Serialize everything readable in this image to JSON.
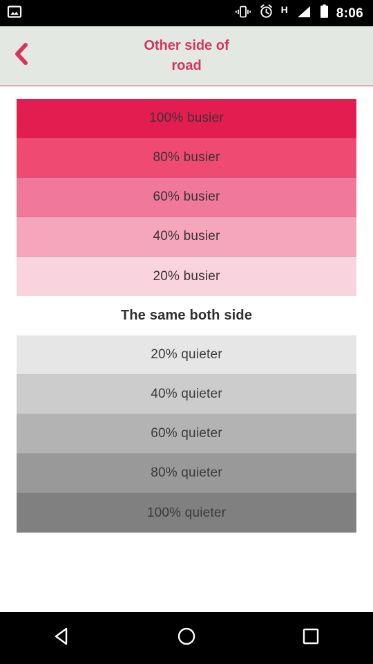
{
  "statusbar": {
    "notification_icon": "image-icon",
    "icons": [
      "vibrate-icon",
      "alarm-icon",
      "signal-icon",
      "battery-icon"
    ],
    "network_label": "H",
    "time": "8:06"
  },
  "header": {
    "back_icon": "chevron-left-icon",
    "title": "Other side of\nroad",
    "accent_color": "#d3355f",
    "background_color": "#e4e8e2"
  },
  "options": {
    "busier": [
      {
        "label": "100% busier",
        "color": "#e41d51"
      },
      {
        "label": "80% busier",
        "color": "#ef4a72"
      },
      {
        "label": "60% busier",
        "color": "#f0789a"
      },
      {
        "label": "40% busier",
        "color": "#f5a6bd"
      },
      {
        "label": "20% busier",
        "color": "#f9d3de"
      }
    ],
    "neutral": {
      "label": "The same both side",
      "color": "#ffffff"
    },
    "quieter": [
      {
        "label": "20% quieter",
        "color": "#e6e6e6"
      },
      {
        "label": "40% quieter",
        "color": "#cccccc"
      },
      {
        "label": "60% quieter",
        "color": "#b3b3b3"
      },
      {
        "label": "80% quieter",
        "color": "#999999"
      },
      {
        "label": "100% quieter",
        "color": "#808080"
      }
    ]
  },
  "navbar": {
    "back": "back-triangle-icon",
    "home": "home-circle-icon",
    "recents": "recents-square-icon"
  }
}
